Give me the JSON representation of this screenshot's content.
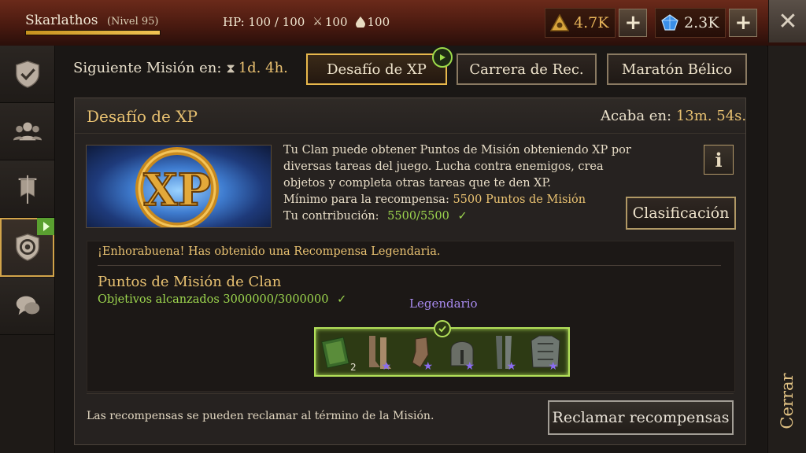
{
  "player": {
    "name": "Skarlathos",
    "level": "(Nivel 95)",
    "level_progress": 1.0
  },
  "stats": {
    "hp": "HP: 100 / 100",
    "attack": "100",
    "drop": "100"
  },
  "currencies": {
    "gold": "4.7K",
    "gems": "2.3K"
  },
  "sidebar": {
    "items": [
      {
        "name": "shield-check",
        "active": false
      },
      {
        "name": "clan-members",
        "active": false
      },
      {
        "name": "banner",
        "active": false
      },
      {
        "name": "mission-shield",
        "active": true
      },
      {
        "name": "chat",
        "active": false
      }
    ]
  },
  "header": {
    "next_mission_label": "Siguiente Misión en:",
    "next_mission_time": "1d. 4h."
  },
  "tabs": [
    {
      "label": "Desafío de XP",
      "active": true
    },
    {
      "label": "Carrera de Rec.",
      "active": false
    },
    {
      "label": "Maratón Bélico",
      "active": false
    }
  ],
  "mission": {
    "title": "Desafío de XP",
    "ends_label": "Acaba en:",
    "ends_time": "13m. 54s.",
    "desc_line1": "Tu Clan puede obtener Puntos de Misión obteniendo XP por",
    "desc_line2": "diversas tareas del juego. Lucha contra enemigos, crea",
    "desc_line3": "objetos y completa otras tareas que te den XP.",
    "min_label": "Mínimo para la recompensa:",
    "min_value": "5500 Puntos de Misión",
    "contrib_label": "Tu contribución:",
    "contrib_value": "5500/5500",
    "info_label": "i",
    "ranking_button": "Clasificación"
  },
  "reward": {
    "congrats": "¡Enhorabuena! Has obtenido una Recompensa Legendaria.",
    "clan_title": "Puntos de Misión de Clan",
    "goal_label": "Objetivos alcanzados",
    "goal_value": "3000000/3000000",
    "tier_label": "Legendario",
    "items": [
      {
        "name": "book",
        "qty": "2"
      },
      {
        "name": "boots",
        "qty": ""
      },
      {
        "name": "gauntlet",
        "qty": ""
      },
      {
        "name": "helmet",
        "qty": ""
      },
      {
        "name": "greaves",
        "qty": ""
      },
      {
        "name": "chest-armor",
        "qty": ""
      }
    ]
  },
  "footer": {
    "note": "Las recompensas se pueden reclamar al término de la Misión.",
    "claim_button": "Reclamar recompensas"
  },
  "close_label": "Cerrar",
  "close_icon": "✕"
}
